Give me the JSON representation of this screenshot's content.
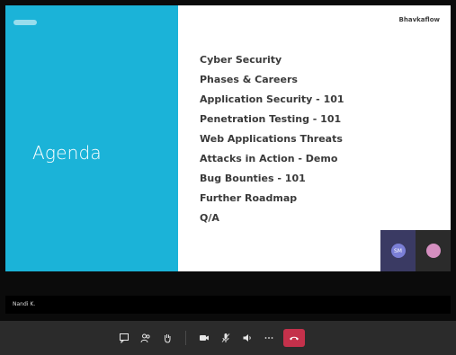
{
  "slide": {
    "title": "Agenda",
    "brand": "Bhavkaflow",
    "items": [
      "Cyber Security",
      "Phases & Careers",
      "Application Security - 101",
      "Penetration Testing - 101",
      "Web Applications Threats",
      "Attacks in Action - Demo",
      "Bug Bounties - 101",
      "Further Roadmap",
      "Q/A"
    ]
  },
  "participants": [
    {
      "initials": "SM",
      "accent": "#7b7fd6"
    },
    {
      "initials": "",
      "accent": "#d58fc0"
    }
  ],
  "presenter": {
    "name": "Nandi K."
  },
  "controls": {
    "icons": [
      "chat-icon",
      "participants-icon",
      "raise-hand-icon",
      "camera-icon",
      "mic-icon",
      "speaker-icon",
      "more-options-icon",
      "hang-up-icon"
    ]
  },
  "colors": {
    "slide_accent": "#1bb3d8",
    "hangup": "#c4314b",
    "call_bar": "#2b2b2b"
  }
}
